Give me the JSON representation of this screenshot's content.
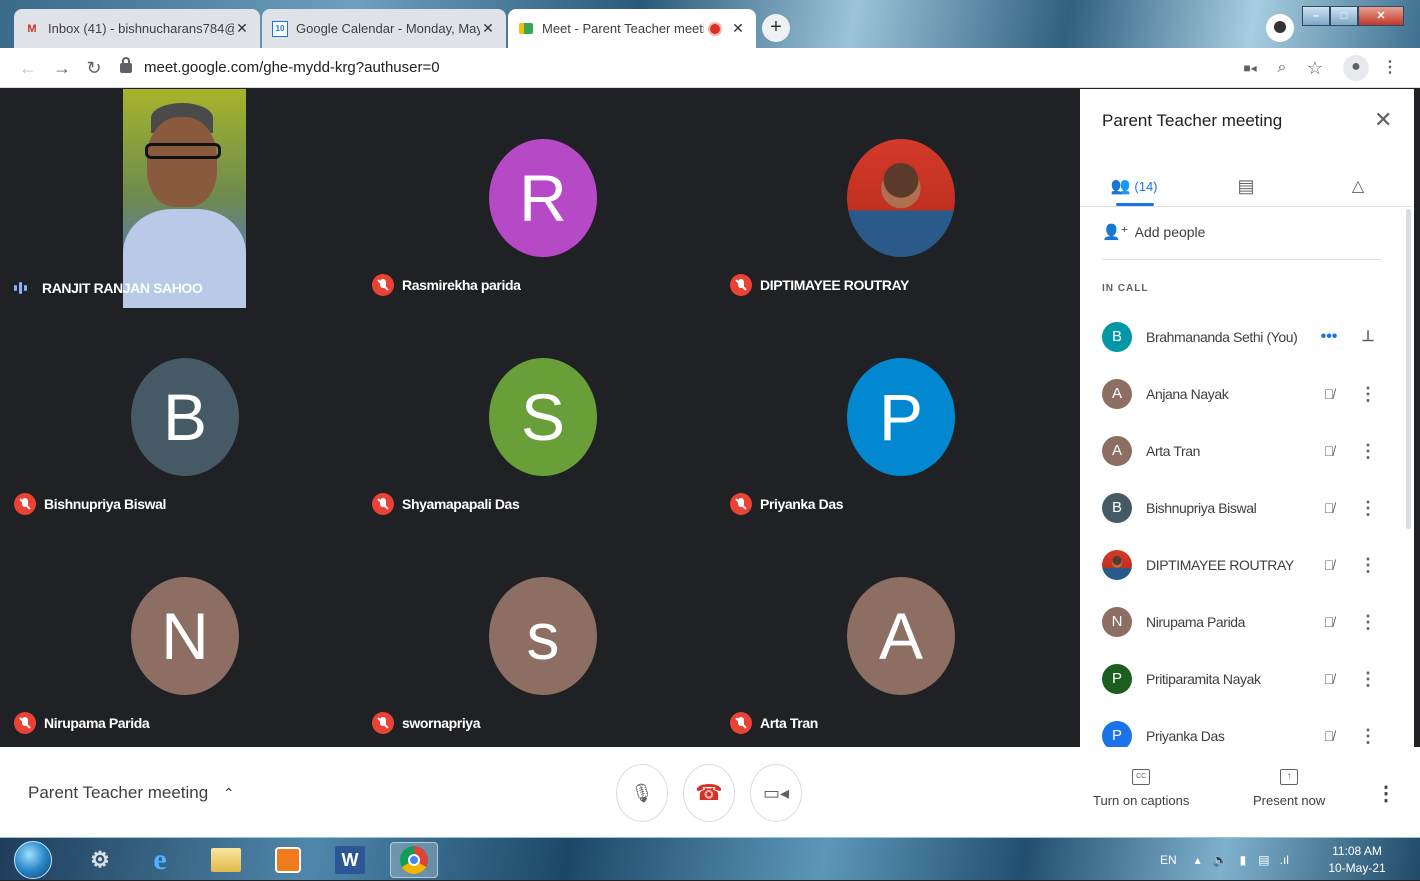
{
  "browser": {
    "tabs": [
      {
        "label": "Inbox (41) - bishnucharans784@",
        "icon": "gmail-icon"
      },
      {
        "label": "Google Calendar - Monday, May",
        "icon": "calendar-icon"
      },
      {
        "label": "Meet - Parent Teacher meeti",
        "icon": "meet-icon",
        "active": true
      }
    ],
    "url": "meet.google.com/ghe-mydd-krg?authuser=0"
  },
  "grid": {
    "tiles": [
      {
        "name": "RANJIT RANJAN SAHOO",
        "type": "video",
        "speaking": true
      },
      {
        "name": "Rasmirekha parida",
        "initial": "R",
        "color": "#b64ac6"
      },
      {
        "name": "DIPTIMAYEE ROUTRAY",
        "type": "photo"
      },
      {
        "name": "Bishnupriya Biswal",
        "initial": "B",
        "color": "#455a64"
      },
      {
        "name": "Shyamapapali Das",
        "initial": "S",
        "color": "#689f38"
      },
      {
        "name": "Priyanka Das",
        "initial": "P",
        "color": "#0288d1"
      },
      {
        "name": "Nirupama Parida",
        "initial": "N",
        "color": "#8d6e63"
      },
      {
        "name": "swornapriya",
        "initial": "s",
        "color": "#8d6e63"
      },
      {
        "name": "Arta Tran",
        "initial": "A",
        "color": "#8d6e63"
      }
    ]
  },
  "panel": {
    "title": "Parent Teacher meeting",
    "people_count": "(14)",
    "add_people": "Add people",
    "section": "IN CALL",
    "participants": [
      {
        "name": "Brahmananda Sethi (You)",
        "initial": "B",
        "color": "#0097a7",
        "self": true
      },
      {
        "name": "Anjana Nayak",
        "initial": "A",
        "color": "#8d6e63"
      },
      {
        "name": "Arta Tran",
        "initial": "A",
        "color": "#8d6e63"
      },
      {
        "name": "Bishnupriya Biswal",
        "initial": "B",
        "color": "#455a64"
      },
      {
        "name": "DIPTIMAYEE ROUTRAY",
        "initial": "",
        "color": "#c0392b",
        "photo": true
      },
      {
        "name": "Nirupama Parida",
        "initial": "N",
        "color": "#8d6e63"
      },
      {
        "name": "Pritiparamita Nayak",
        "initial": "P",
        "color": "#1b5e20"
      },
      {
        "name": "Priyanka Das",
        "initial": "P",
        "color": "#1a73e8"
      }
    ]
  },
  "bottom": {
    "meeting_name": "Parent Teacher meeting",
    "captions_label": "Turn on captions",
    "captions_icon_text": "CC",
    "present_label": "Present now"
  },
  "taskbar": {
    "language": "EN",
    "time": "11:08 AM",
    "date": "10-May-21"
  }
}
